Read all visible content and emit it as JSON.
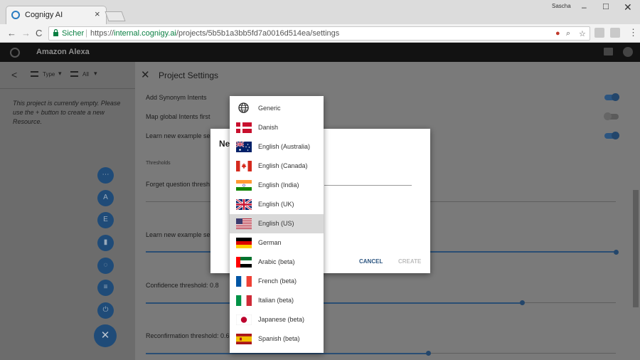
{
  "browser": {
    "tab_title": "Cognigy AI",
    "tab_close": "×",
    "user_name": "Sascha",
    "window_controls": {
      "minimize": "–",
      "maximize": "□",
      "close": "✕"
    },
    "nav": {
      "back": "←",
      "forward": "→",
      "reload": "C"
    },
    "secure_label": "Sicher",
    "url_scheme": "https://",
    "url_host": "internal.cognigy.ai",
    "url_path": "/projects/5b5b1a3bb5fd7a0016d514ea/settings",
    "menu": "⋮",
    "omni_icons": [
      "●",
      "⌕",
      "☆"
    ]
  },
  "app": {
    "project_title": "Amazon Alexa"
  },
  "sidebar": {
    "back": "<",
    "filter_type_label": "Type",
    "filter_all_label": "All",
    "caret": "▾",
    "empty_message": "This project is currently empty. Please use the + button to create a new Resource.",
    "fab_icons": [
      "flow-icon",
      "lexicon-icon",
      "intent-icon",
      "endpoint-icon",
      "idea-icon",
      "task-icon",
      "plug-icon"
    ],
    "fab_glyphs": [
      "⋯",
      "A",
      "E",
      "▮",
      "◌",
      "≡",
      "⏻"
    ],
    "add_glyph": "✕"
  },
  "settings": {
    "close": "✕",
    "title": "Project Settings",
    "toggles": [
      {
        "label": "Add Synonym Intents",
        "on": true
      },
      {
        "label": "Map global Intents first",
        "on": false
      },
      {
        "label": "Learn new example se",
        "on": true
      }
    ],
    "section_thresholds": "Thresholds",
    "sliders": [
      {
        "label": "Forget question thresh",
        "value": 0
      },
      {
        "label": "Learn new example se",
        "value": 1.0
      },
      {
        "label": "Confidence threshold: 0.8",
        "value": 0.8
      },
      {
        "label": "Reconfirmation threshold: 0.6",
        "value": 0.6
      }
    ]
  },
  "dialog": {
    "title_partial": "Ne",
    "cancel": "CANCEL",
    "create": "CREATE"
  },
  "languages": [
    {
      "label": "Generic",
      "flag": "globe",
      "selected": false
    },
    {
      "label": "Danish",
      "flag": "dk",
      "selected": false
    },
    {
      "label": "English (Australia)",
      "flag": "au",
      "selected": false
    },
    {
      "label": "English (Canada)",
      "flag": "ca",
      "selected": false
    },
    {
      "label": "English (India)",
      "flag": "in",
      "selected": false
    },
    {
      "label": "English (UK)",
      "flag": "gb",
      "selected": false
    },
    {
      "label": "English (US)",
      "flag": "us",
      "selected": true
    },
    {
      "label": "German",
      "flag": "de",
      "selected": false
    },
    {
      "label": "Arabic (beta)",
      "flag": "ae",
      "selected": false
    },
    {
      "label": "French (beta)",
      "flag": "fr",
      "selected": false
    },
    {
      "label": "Italian (beta)",
      "flag": "it",
      "selected": false
    },
    {
      "label": "Japanese (beta)",
      "flag": "jp",
      "selected": false
    },
    {
      "label": "Spanish (beta)",
      "flag": "es",
      "selected": false
    }
  ]
}
